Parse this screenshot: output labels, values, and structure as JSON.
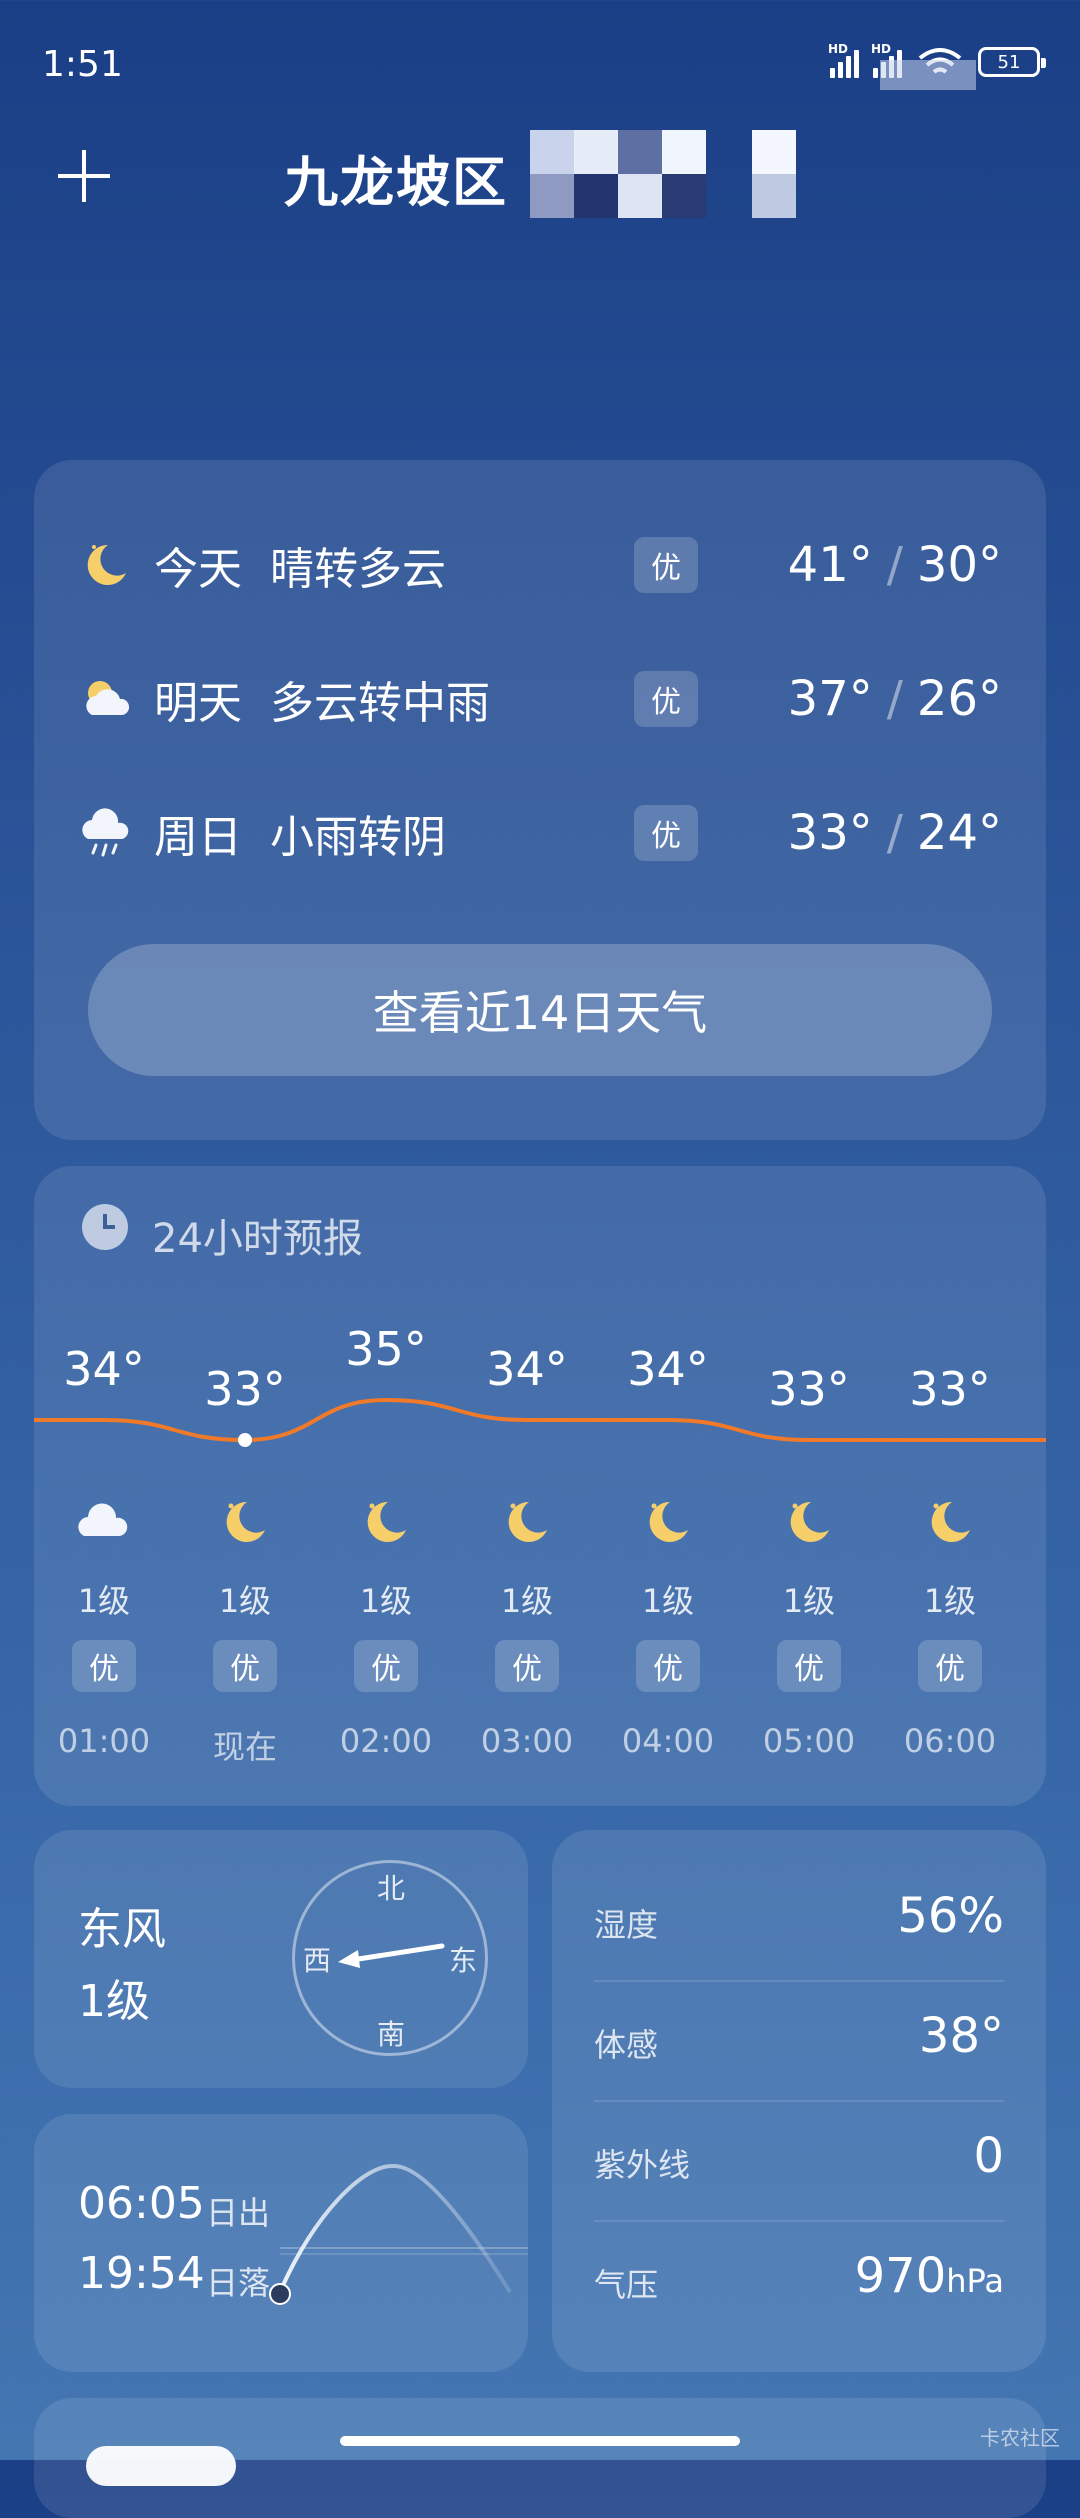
{
  "status_bar": {
    "time": "1:51",
    "battery": "51",
    "network_1": "HD",
    "network_2": "HD"
  },
  "header": {
    "city": "九龙坡区"
  },
  "forecast": {
    "days": [
      {
        "day": "今天",
        "condition": "晴转多云",
        "aqi": "优",
        "high": "41°",
        "low": "30°",
        "icon": "moon-icon"
      },
      {
        "day": "明天",
        "condition": "多云转中雨",
        "aqi": "优",
        "high": "37°",
        "low": "26°",
        "icon": "partly-cloudy-icon"
      },
      {
        "day": "周日",
        "condition": "小雨转阴",
        "aqi": "优",
        "high": "33°",
        "low": "24°",
        "icon": "light-rain-icon"
      }
    ],
    "separator": "/",
    "button_label": "查看近14日天气"
  },
  "hourly": {
    "title": "24小时预报",
    "items": [
      {
        "temp": "34°",
        "value": 34,
        "icon": "cloudy-icon",
        "wind": "1级",
        "aqi": "优",
        "time": "01:00"
      },
      {
        "temp": "33°",
        "value": 33,
        "icon": "moon-icon",
        "wind": "1级",
        "aqi": "优",
        "time": "现在"
      },
      {
        "temp": "35°",
        "value": 35,
        "icon": "moon-icon",
        "wind": "1级",
        "aqi": "优",
        "time": "02:00"
      },
      {
        "temp": "34°",
        "value": 34,
        "icon": "moon-icon",
        "wind": "1级",
        "aqi": "优",
        "time": "03:00"
      },
      {
        "temp": "34°",
        "value": 34,
        "icon": "moon-icon",
        "wind": "1级",
        "aqi": "优",
        "time": "04:00"
      },
      {
        "temp": "33°",
        "value": 33,
        "icon": "moon-icon",
        "wind": "1级",
        "aqi": "优",
        "time": "05:00"
      },
      {
        "temp": "33°",
        "value": 33,
        "icon": "moon-icon",
        "wind": "1级",
        "aqi": "优",
        "time": "06:00"
      }
    ],
    "line_color": "#f07a2a"
  },
  "wind": {
    "direction": "东风",
    "level": "1级",
    "compass": {
      "north": "北",
      "south": "南",
      "east": "东",
      "west": "西"
    }
  },
  "sun": {
    "sunrise": "06:05",
    "sunrise_label": "日出",
    "sunset": "19:54",
    "sunset_label": "日落"
  },
  "details": [
    {
      "label": "湿度",
      "value": "56%",
      "unit": ""
    },
    {
      "label": "体感",
      "value": "38°",
      "unit": ""
    },
    {
      "label": "紫外线",
      "value": "0",
      "unit": ""
    },
    {
      "label": "气压",
      "value": "970",
      "unit": "hPa"
    }
  ],
  "watermark": "卡农社区"
}
